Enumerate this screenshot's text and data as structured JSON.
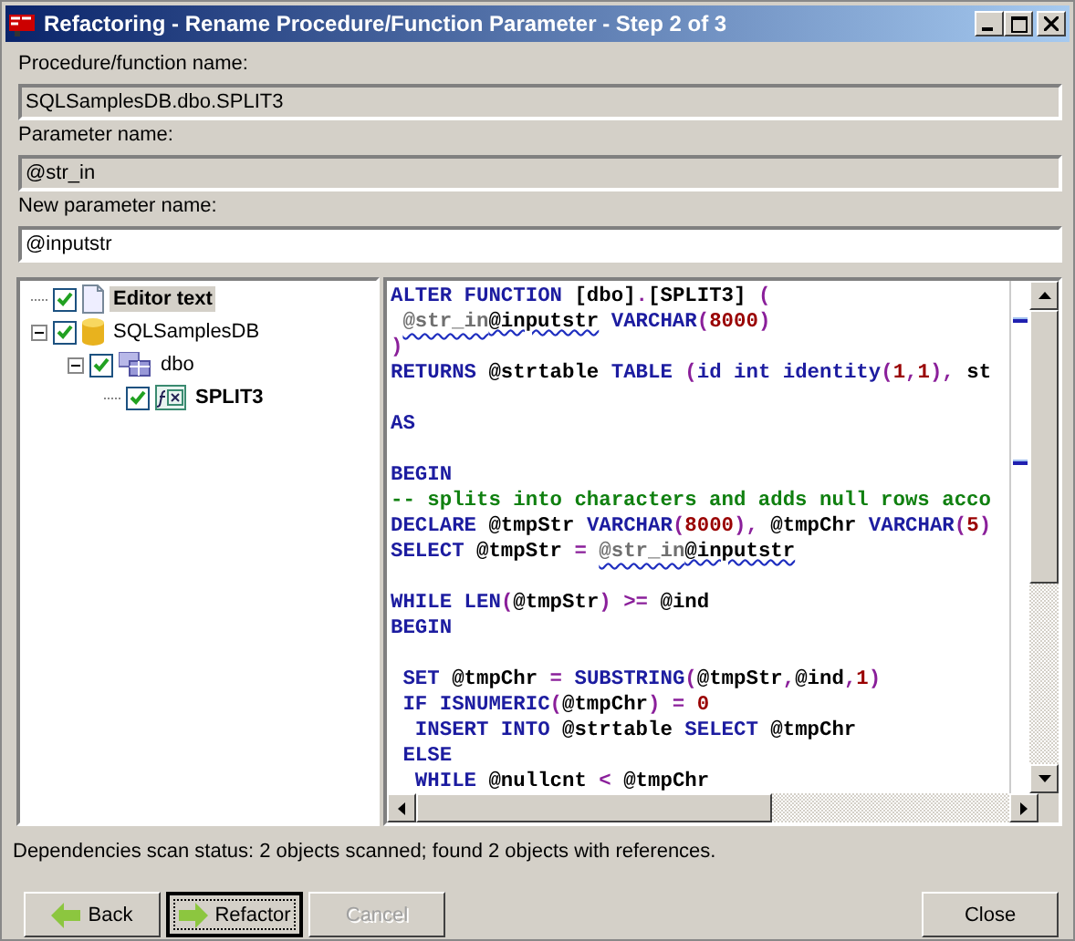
{
  "window": {
    "title": "Refactoring - Rename Procedure/Function Parameter - Step 2 of 3"
  },
  "fields": [
    {
      "label": "Procedure/function name:",
      "value": "SQLSamplesDB.dbo.SPLIT3",
      "disabled": true
    },
    {
      "label": "Parameter name:",
      "value": "@str_in",
      "disabled": true
    },
    {
      "label": "New parameter name:",
      "value": "@inputstr",
      "disabled": false
    }
  ],
  "tree": [
    {
      "label": "Editor text",
      "kind": "document",
      "checked": true,
      "bold": true,
      "selected": true
    },
    {
      "label": "SQLSamplesDB",
      "kind": "database",
      "checked": true,
      "bold": false,
      "selected": false,
      "expanded": true,
      "children": [
        {
          "label": "dbo",
          "kind": "schema",
          "checked": true,
          "bold": false,
          "selected": false,
          "expanded": true,
          "children": [
            {
              "label": "SPLIT3",
              "kind": "function",
              "checked": true,
              "bold": true,
              "selected": false
            }
          ]
        }
      ]
    }
  ],
  "editor": {
    "lines": [
      {
        "kind": "code",
        "tokens": [
          {
            "kind": "kw",
            "text": "ALTER FUNCTION "
          },
          {
            "kind": "plain",
            "text": "[dbo]"
          },
          {
            "kind": "op",
            "text": "."
          },
          {
            "kind": "plain",
            "text": "[SPLIT3] "
          },
          {
            "kind": "op",
            "text": "("
          }
        ]
      },
      {
        "kind": "indented",
        "tokens": [
          {
            "kind": "old",
            "text": "@str_in"
          },
          {
            "kind": "new",
            "text": "@inputstr"
          },
          {
            "kind": "kw",
            "text": " VARCHAR"
          },
          {
            "kind": "op",
            "text": "("
          },
          {
            "kind": "num",
            "text": "8000"
          },
          {
            "kind": "op",
            "text": ")"
          }
        ]
      },
      {
        "kind": "code",
        "tokens": [
          {
            "kind": "op",
            "text": ")"
          }
        ]
      },
      {
        "kind": "code",
        "tokens": [
          {
            "kind": "kw",
            "text": "RETURNS "
          },
          {
            "kind": "plain",
            "text": "@strtable "
          },
          {
            "kind": "kw",
            "text": "TABLE "
          },
          {
            "kind": "op",
            "text": "("
          },
          {
            "kind": "kw",
            "text": "id int identity"
          },
          {
            "kind": "op",
            "text": "("
          },
          {
            "kind": "num",
            "text": "1"
          },
          {
            "kind": "op",
            "text": ","
          },
          {
            "kind": "num",
            "text": "1"
          },
          {
            "kind": "op",
            "text": "),"
          },
          {
            "kind": "plain",
            "text": " st"
          }
        ]
      },
      {
        "kind": "blank"
      },
      {
        "kind": "code",
        "tokens": [
          {
            "kind": "kw",
            "text": "AS"
          }
        ]
      },
      {
        "kind": "blank"
      },
      {
        "kind": "code",
        "tokens": [
          {
            "kind": "kw",
            "text": "BEGIN"
          }
        ]
      },
      {
        "kind": "code",
        "tokens": [
          {
            "kind": "comment",
            "text": "-- splits into characters and adds null rows acco"
          }
        ]
      },
      {
        "kind": "code",
        "tokens": [
          {
            "kind": "kw",
            "text": "DECLARE "
          },
          {
            "kind": "plain",
            "text": "@tmpStr "
          },
          {
            "kind": "kw",
            "text": "VARCHAR"
          },
          {
            "kind": "op",
            "text": "("
          },
          {
            "kind": "num",
            "text": "8000"
          },
          {
            "kind": "op",
            "text": "),"
          },
          {
            "kind": "plain",
            "text": " @tmpChr "
          },
          {
            "kind": "kw",
            "text": "VARCHAR"
          },
          {
            "kind": "op",
            "text": "("
          },
          {
            "kind": "num",
            "text": "5"
          },
          {
            "kind": "op",
            "text": ")"
          }
        ]
      },
      {
        "kind": "code",
        "tokens": [
          {
            "kind": "kw",
            "text": "SELECT "
          },
          {
            "kind": "plain",
            "text": "@tmpStr "
          },
          {
            "kind": "op",
            "text": "= "
          },
          {
            "kind": "old",
            "text": "@str_in"
          },
          {
            "kind": "new",
            "text": "@inputstr"
          }
        ]
      },
      {
        "kind": "blank"
      },
      {
        "kind": "code",
        "tokens": [
          {
            "kind": "kw",
            "text": "WHILE LEN"
          },
          {
            "kind": "op",
            "text": "("
          },
          {
            "kind": "plain",
            "text": "@tmpStr"
          },
          {
            "kind": "op",
            "text": ") >="
          },
          {
            "kind": "plain",
            "text": " @ind"
          }
        ]
      },
      {
        "kind": "code",
        "tokens": [
          {
            "kind": "kw",
            "text": "BEGIN"
          }
        ]
      },
      {
        "kind": "blank"
      },
      {
        "kind": "code",
        "tokens": [
          {
            "kind": "kw",
            "text": " SET "
          },
          {
            "kind": "plain",
            "text": "@tmpChr "
          },
          {
            "kind": "op",
            "text": "="
          },
          {
            "kind": "kw",
            "text": " SUBSTRING"
          },
          {
            "kind": "op",
            "text": "("
          },
          {
            "kind": "plain",
            "text": "@tmpStr"
          },
          {
            "kind": "op",
            "text": ","
          },
          {
            "kind": "plain",
            "text": "@ind"
          },
          {
            "kind": "op",
            "text": ","
          },
          {
            "kind": "num",
            "text": "1"
          },
          {
            "kind": "op",
            "text": ")"
          }
        ]
      },
      {
        "kind": "code",
        "tokens": [
          {
            "kind": "kw",
            "text": " IF ISNUMERIC"
          },
          {
            "kind": "op",
            "text": "("
          },
          {
            "kind": "plain",
            "text": "@tmpChr"
          },
          {
            "kind": "op",
            "text": ") = "
          },
          {
            "kind": "num",
            "text": "0"
          }
        ]
      },
      {
        "kind": "code",
        "tokens": [
          {
            "kind": "kw",
            "text": "  INSERT INTO "
          },
          {
            "kind": "plain",
            "text": "@strtable "
          },
          {
            "kind": "kw",
            "text": "SELECT "
          },
          {
            "kind": "plain",
            "text": "@tmpChr"
          }
        ]
      },
      {
        "kind": "code",
        "tokens": [
          {
            "kind": "kw",
            "text": " ELSE"
          }
        ]
      },
      {
        "kind": "code",
        "tokens": [
          {
            "kind": "kw",
            "text": "  WHILE "
          },
          {
            "kind": "plain",
            "text": "@nullcnt "
          },
          {
            "kind": "op",
            "text": "<"
          },
          {
            "kind": "plain",
            "text": " @tmpChr"
          }
        ]
      }
    ]
  },
  "status_bar": {
    "text": "Dependencies scan status: 2 objects scanned; found 2 objects with references."
  },
  "buttons": [
    {
      "label": "Back",
      "kind": "back",
      "disabled": false,
      "default": false
    },
    {
      "label": "Refactor",
      "kind": "forward",
      "disabled": false,
      "default": true
    },
    {
      "label": "Cancel",
      "kind": "plain",
      "disabled": true,
      "default": false
    },
    {
      "label": "Close",
      "kind": "plain",
      "disabled": false,
      "default": false
    }
  ]
}
